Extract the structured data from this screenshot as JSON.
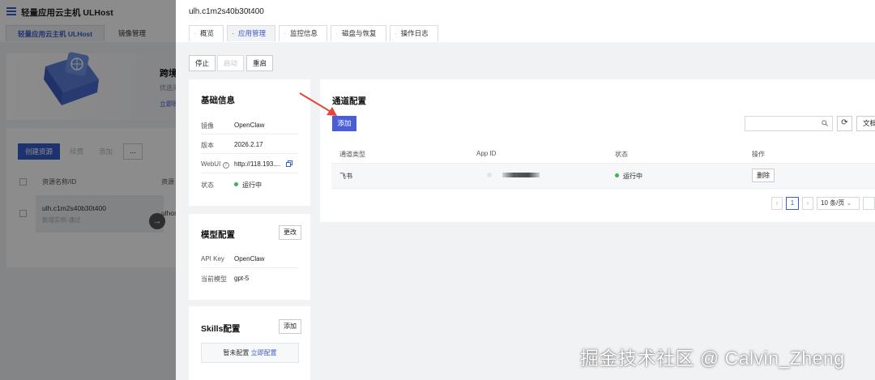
{
  "background_page": {
    "app_title": "轻量应用云主机 ULHost",
    "tabs": [
      "轻量应用云主机 ULHost",
      "镜像管理"
    ],
    "banner": {
      "title": "跨境",
      "subtitle": "优选海",
      "link": "立即购"
    },
    "toolbar": {
      "create": "创建资源",
      "btn2": "续费",
      "btn3": "添加",
      "more": "..."
    },
    "table": {
      "headers": [
        "资源名称/ID",
        "资源"
      ],
      "row": {
        "name": "ulh.c1m2s40b30t400",
        "sub": "新增实例-通过",
        "type": "ulhost"
      }
    },
    "arrow_glyph": "→"
  },
  "drawer": {
    "title": "ulh.c1m2s40b30t400",
    "tabs": [
      "概览",
      "应用管理",
      "监控信息",
      "磁盘与恢复",
      "操作日志"
    ],
    "active_tab": "应用管理",
    "actions": {
      "stop": "停止",
      "start": "启动",
      "restart": "重启"
    },
    "basic_info": {
      "title": "基础信息",
      "rows": [
        {
          "key": "镜像",
          "value": "OpenClaw"
        },
        {
          "key": "版本",
          "value": "2026.2.17"
        },
        {
          "key": "WebUI",
          "value": "http://118.193...."
        },
        {
          "key": "状态",
          "value": "运行中"
        }
      ]
    },
    "model_config": {
      "title": "模型配置",
      "edit_button": "更改",
      "rows": [
        {
          "key": "API Key",
          "value": "OpenClaw"
        },
        {
          "key": "当前模型",
          "value": "gpt-5"
        }
      ]
    },
    "skills_config": {
      "title": "Skills配置",
      "add_button": "添加",
      "empty_text": "暂未配置",
      "empty_link": "立即配置"
    },
    "channel_config": {
      "title": "通道配置",
      "add_button": "添加",
      "search_placeholder": "",
      "doc_button": "文档",
      "refresh_glyph": "⟳",
      "columns": [
        "通道类型",
        "App ID",
        "状态",
        "操作"
      ],
      "rows": [
        {
          "type": "飞书",
          "app_id": "",
          "status": "运行中",
          "action": "删除"
        }
      ],
      "pagination": {
        "prev": "‹",
        "current_page": "1",
        "next": "›",
        "page_size": "10 条/页"
      }
    }
  },
  "watermark": "掘金技术社区 @ Calvin_Zheng",
  "colors": {
    "accent": "#3a5ccc",
    "primary_button": "#4a5fd6",
    "status_ok": "#3bb54a",
    "arrow": "#e5463a"
  }
}
